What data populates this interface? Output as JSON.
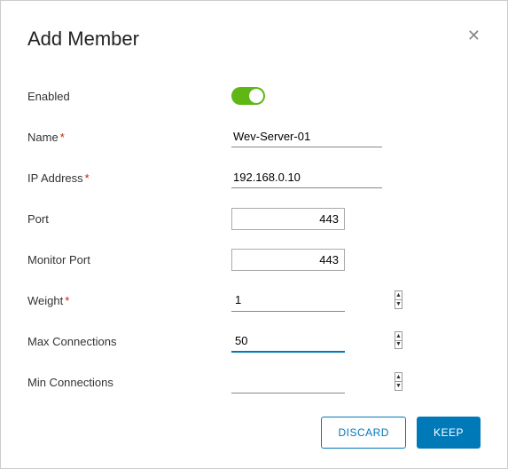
{
  "dialog": {
    "title": "Add Member"
  },
  "fields": {
    "enabled_label": "Enabled",
    "enabled_value": true,
    "name_label": "Name",
    "name_value": "Wev-Server-01",
    "ip_label": "IP Address",
    "ip_value": "192.168.0.10",
    "port_label": "Port",
    "port_value": "443",
    "monitor_port_label": "Monitor Port",
    "monitor_port_value": "443",
    "weight_label": "Weight",
    "weight_value": "1",
    "max_conn_label": "Max Connections",
    "max_conn_value": "50",
    "min_conn_label": "Min Connections",
    "min_conn_value": ""
  },
  "buttons": {
    "discard": "Discard",
    "keep": "Keep"
  }
}
